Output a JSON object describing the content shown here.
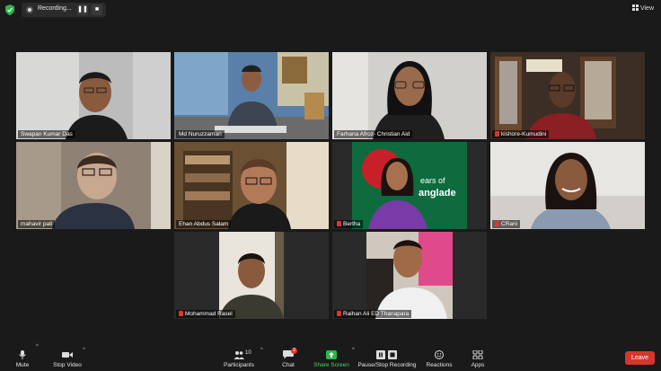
{
  "top": {
    "recording_label": "Recording...",
    "pause_symbol": "❚❚",
    "stop_symbol": "■",
    "view_label": "View"
  },
  "participants": [
    {
      "name": "Swapan Kumar Das",
      "muted": false,
      "active": false
    },
    {
      "name": "Md Nuruzzaman",
      "muted": false,
      "active": true
    },
    {
      "name": "Farhana Afroz- Christian Aid",
      "muted": false,
      "active": false
    },
    {
      "name": "kishore-Kumudini",
      "muted": true,
      "active": false
    },
    {
      "name": "mahavir pati",
      "muted": false,
      "active": false
    },
    {
      "name": "Ehan Abdus Salam",
      "muted": false,
      "active": false
    },
    {
      "name": "Bertha",
      "muted": true,
      "active": false
    },
    {
      "name": "CRani",
      "muted": true,
      "active": false
    },
    {
      "name": "Mohammad Rasel",
      "muted": true,
      "active": false
    },
    {
      "name": "Raihan Ali ED Thanapara",
      "muted": true,
      "active": false
    }
  ],
  "banner_text": [
    "ears of",
    "anglade"
  ],
  "toolbar": {
    "mute": "Mute",
    "stop_video": "Stop Video",
    "participants": "Participants",
    "participants_count": "10",
    "chat": "Chat",
    "chat_badge": "3",
    "share_screen": "Share Screen",
    "pause_recording": "Pause/Stop Recording",
    "reactions": "Reactions",
    "apps": "Apps",
    "leave": "Leave"
  },
  "colors": {
    "background": "#1a1a1a",
    "active_speaker": "#d6e64a",
    "share_green": "#2fb34a",
    "leave_red": "#d9352c",
    "muted_red": "#e0342a"
  }
}
